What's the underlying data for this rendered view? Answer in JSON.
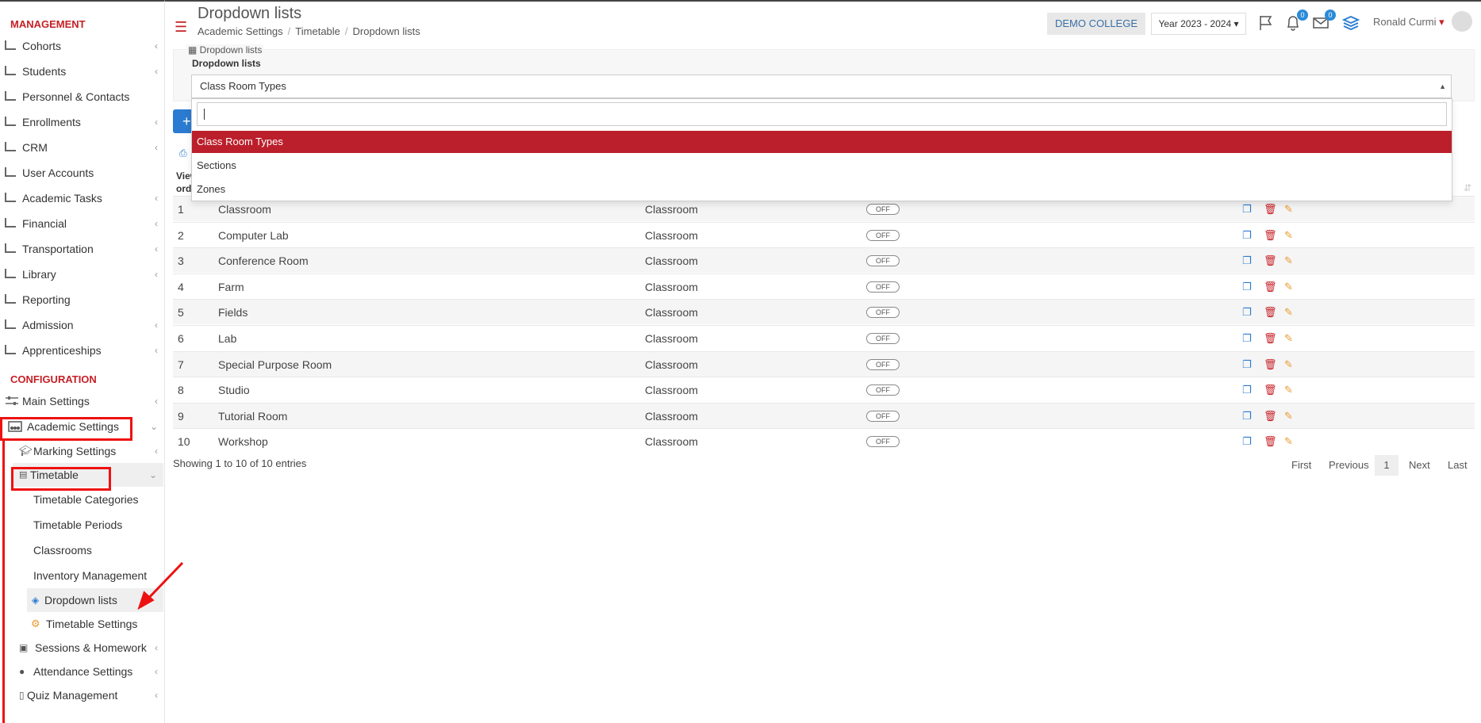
{
  "sidebar": {
    "management_title": "MANAGEMENT",
    "management_items": [
      {
        "label": "Cohorts",
        "icon": "cohorts-icon"
      },
      {
        "label": "Students",
        "icon": "students-icon"
      },
      {
        "label": "Personnel & Contacts",
        "icon": "personnel-icon"
      },
      {
        "label": "Enrollments",
        "icon": "enrollments-icon"
      },
      {
        "label": "CRM",
        "icon": "crm-icon"
      },
      {
        "label": "User Accounts",
        "icon": "key-icon"
      },
      {
        "label": "Academic Tasks",
        "icon": "tasks-icon"
      },
      {
        "label": "Financial",
        "icon": "financial-icon"
      },
      {
        "label": "Transportation",
        "icon": "bus-icon"
      },
      {
        "label": "Library",
        "icon": "library-icon"
      },
      {
        "label": "Reporting",
        "icon": "printer-icon"
      },
      {
        "label": "Admission",
        "icon": "bank-icon"
      },
      {
        "label": "Apprenticeships",
        "icon": "box-icon"
      }
    ],
    "configuration_title": "CONFIGURATION",
    "main_settings": "Main Settings",
    "academic_settings": "Academic Settings",
    "marking_settings": "Marking Settings",
    "timetable": "Timetable",
    "timetable_sub": [
      "Timetable Categories",
      "Timetable Periods",
      "Classrooms",
      "Inventory Management"
    ],
    "dropdown_lists": "Dropdown lists",
    "timetable_settings": "Timetable Settings",
    "sessions_homework": "Sessions & Homework",
    "attendance_settings": "Attendance Settings",
    "quiz_management": "Quiz Management"
  },
  "header": {
    "title": "Dropdown lists",
    "breadcrumb": [
      "Academic Settings",
      "Timetable",
      "Dropdown lists"
    ],
    "college": "DEMO COLLEGE",
    "year": "Year 2023 - 2024",
    "notifications_count": "0",
    "messages_count": "0",
    "user_name": "Ronald Curmi"
  },
  "panel": {
    "legend": "Dropdown lists",
    "label": "Dropdown lists",
    "selected": "Class Room Types"
  },
  "dropdown": {
    "options": [
      "Class Room Types",
      "Sections",
      "Zones"
    ]
  },
  "table": {
    "head_line1": "View",
    "head_line2": "ord",
    "rows": [
      {
        "num": "1",
        "name": "Classroom",
        "type": "Classroom",
        "toggle": "OFF"
      },
      {
        "num": "2",
        "name": "Computer Lab",
        "type": "Classroom",
        "toggle": "OFF"
      },
      {
        "num": "3",
        "name": "Conference Room",
        "type": "Classroom",
        "toggle": "OFF"
      },
      {
        "num": "4",
        "name": "Farm",
        "type": "Classroom",
        "toggle": "OFF"
      },
      {
        "num": "5",
        "name": "Fields",
        "type": "Classroom",
        "toggle": "OFF"
      },
      {
        "num": "6",
        "name": "Lab",
        "type": "Classroom",
        "toggle": "OFF"
      },
      {
        "num": "7",
        "name": "Special Purpose Room",
        "type": "Classroom",
        "toggle": "OFF"
      },
      {
        "num": "8",
        "name": "Studio",
        "type": "Classroom",
        "toggle": "OFF"
      },
      {
        "num": "9",
        "name": "Tutorial Room",
        "type": "Classroom",
        "toggle": "OFF"
      },
      {
        "num": "10",
        "name": "Workshop",
        "type": "Classroom",
        "toggle": "OFF"
      }
    ],
    "showing": "Showing 1 to 10 of 10 entries"
  },
  "pagination": {
    "first": "First",
    "previous": "Previous",
    "current": "1",
    "next": "Next",
    "last": "Last"
  },
  "colors": {
    "brand_red": "#c62026",
    "selected_option": "#bb1f2b",
    "primary_blue": "#2a7bd1",
    "annotation_red": "#ee1111"
  }
}
